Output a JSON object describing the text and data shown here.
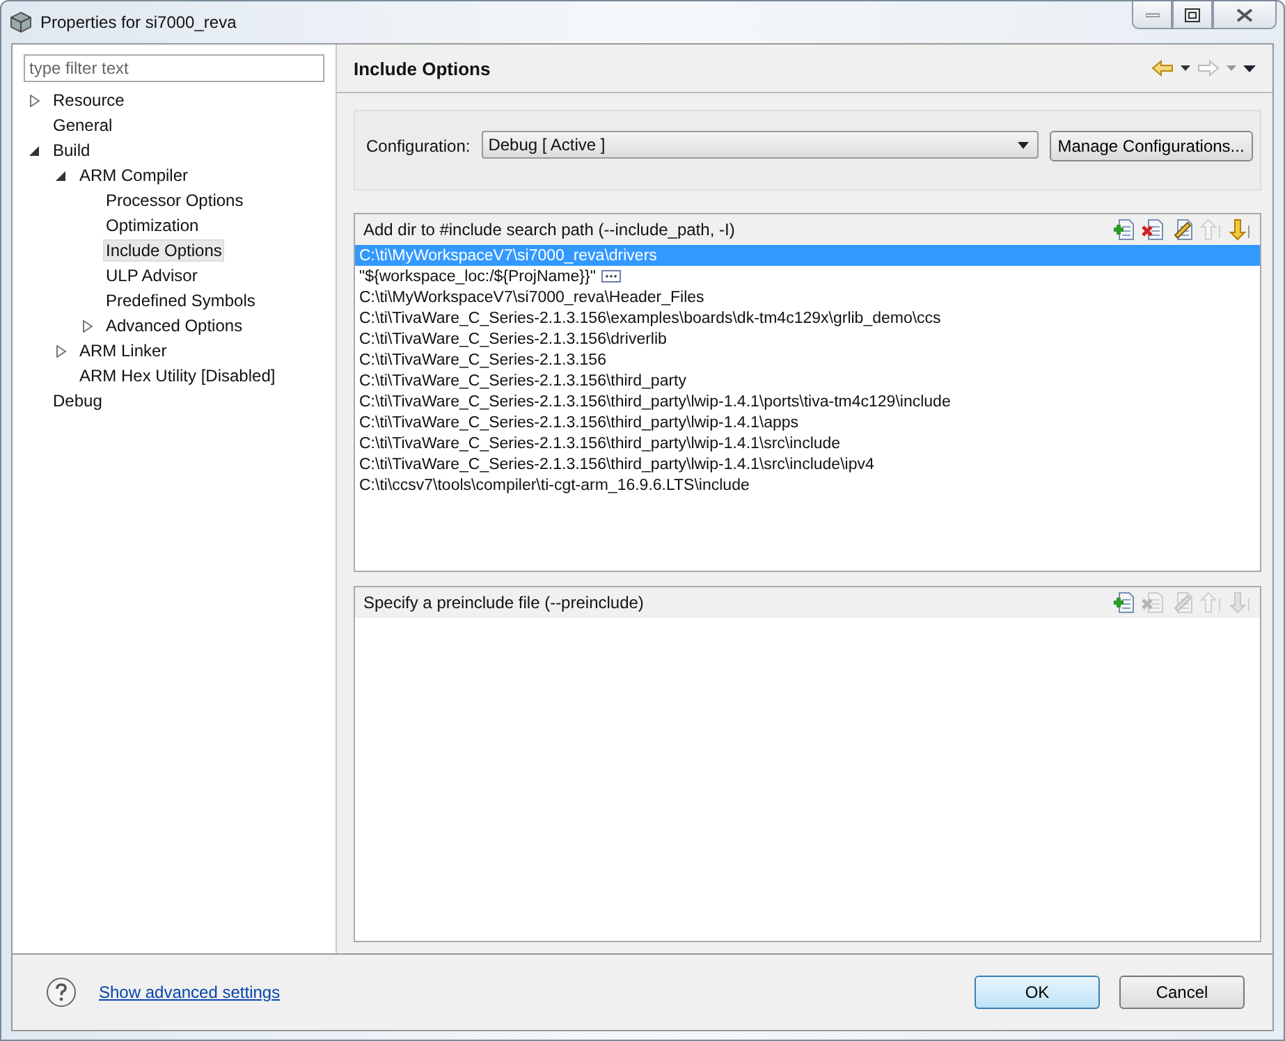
{
  "window": {
    "title": "Properties for si7000_reva"
  },
  "filter": {
    "placeholder": "type filter text"
  },
  "tree": [
    {
      "label": "Resource",
      "expanded": false,
      "selected": false
    },
    {
      "label": "General",
      "selected": false
    },
    {
      "label": "Build",
      "expanded": true,
      "selected": false,
      "children": [
        {
          "label": "ARM Compiler",
          "expanded": true,
          "selected": false,
          "children": [
            {
              "label": "Processor Options",
              "selected": false
            },
            {
              "label": "Optimization",
              "selected": false
            },
            {
              "label": "Include Options",
              "selected": true
            },
            {
              "label": "ULP Advisor",
              "selected": false
            },
            {
              "label": "Predefined Symbols",
              "selected": false
            },
            {
              "label": "Advanced Options",
              "expanded": false,
              "selected": false
            }
          ]
        },
        {
          "label": "ARM Linker",
          "expanded": false,
          "selected": false
        },
        {
          "label": "ARM Hex Utility  [Disabled]",
          "selected": false
        }
      ]
    },
    {
      "label": "Debug",
      "selected": false
    }
  ],
  "page": {
    "title": "Include Options",
    "nav": [
      {
        "kind": "back",
        "disabled": false
      },
      {
        "kind": "forward",
        "disabled": true
      },
      {
        "kind": "menu",
        "disabled": false
      }
    ]
  },
  "configuration": {
    "label": "Configuration:",
    "value": "Debug  [ Active ]",
    "button": "Manage Configurations..."
  },
  "lists": [
    {
      "title": "Add dir to #include search path (--include_path, -I)",
      "tools": [
        {
          "kind": "add",
          "disabled": false
        },
        {
          "kind": "delete",
          "disabled": false
        },
        {
          "kind": "edit",
          "disabled": false
        },
        {
          "kind": "up",
          "disabled": true
        },
        {
          "kind": "down",
          "disabled": false
        }
      ],
      "items": [
        {
          "text": "C:\\ti\\MyWorkspaceV7\\si7000_reva\\drivers",
          "selected": true,
          "variable": false
        },
        {
          "text": "\"${workspace_loc:/${ProjName}}\"",
          "selected": false,
          "variable": true
        },
        {
          "text": "C:\\ti\\MyWorkspaceV7\\si7000_reva\\Header_Files",
          "selected": false,
          "variable": false
        },
        {
          "text": "C:\\ti\\TivaWare_C_Series-2.1.3.156\\examples\\boards\\dk-tm4c129x\\grlib_demo\\ccs",
          "selected": false,
          "variable": false
        },
        {
          "text": "C:\\ti\\TivaWare_C_Series-2.1.3.156\\driverlib",
          "selected": false,
          "variable": false
        },
        {
          "text": "C:\\ti\\TivaWare_C_Series-2.1.3.156",
          "selected": false,
          "variable": false
        },
        {
          "text": "C:\\ti\\TivaWare_C_Series-2.1.3.156\\third_party",
          "selected": false,
          "variable": false
        },
        {
          "text": "C:\\ti\\TivaWare_C_Series-2.1.3.156\\third_party\\lwip-1.4.1\\ports\\tiva-tm4c129\\include",
          "selected": false,
          "variable": false
        },
        {
          "text": "C:\\ti\\TivaWare_C_Series-2.1.3.156\\third_party\\lwip-1.4.1\\apps",
          "selected": false,
          "variable": false
        },
        {
          "text": "C:\\ti\\TivaWare_C_Series-2.1.3.156\\third_party\\lwip-1.4.1\\src\\include",
          "selected": false,
          "variable": false
        },
        {
          "text": "C:\\ti\\TivaWare_C_Series-2.1.3.156\\third_party\\lwip-1.4.1\\src\\include\\ipv4",
          "selected": false,
          "variable": false
        },
        {
          "text": "C:\\ti\\ccsv7\\tools\\compiler\\ti-cgt-arm_16.9.6.LTS\\include",
          "selected": false,
          "variable": false
        }
      ]
    },
    {
      "title": "Specify a preinclude file (--preinclude)",
      "tools": [
        {
          "kind": "add",
          "disabled": false
        },
        {
          "kind": "delete",
          "disabled": true
        },
        {
          "kind": "edit",
          "disabled": true
        },
        {
          "kind": "up",
          "disabled": true
        },
        {
          "kind": "down",
          "disabled": true
        }
      ]
    }
  ],
  "footer": {
    "link": "Show advanced settings",
    "buttons": [
      {
        "label": "OK",
        "default": true
      },
      {
        "label": "Cancel",
        "default": false
      }
    ]
  }
}
